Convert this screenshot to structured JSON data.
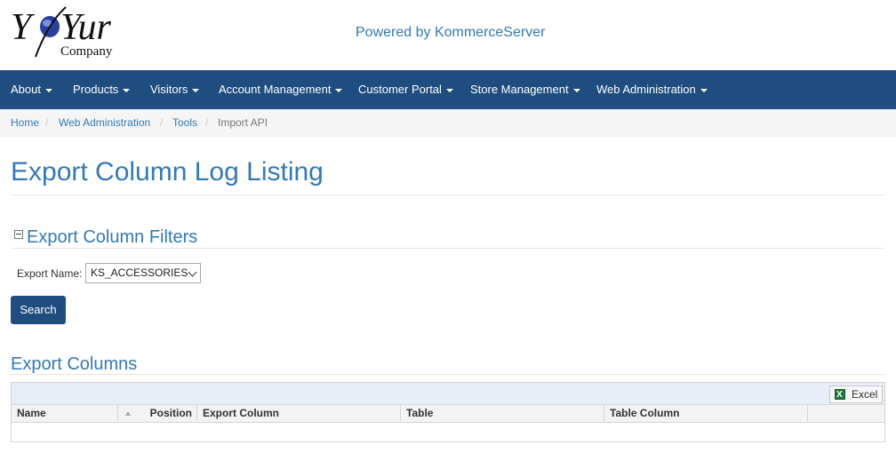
{
  "header": {
    "logo": {
      "main_text": "Yur",
      "sub_text": "Company"
    },
    "powered_by": "Powered by KommerceServer"
  },
  "nav": {
    "items": [
      {
        "label": "About"
      },
      {
        "label": "Products"
      },
      {
        "label": "Visitors"
      },
      {
        "label": "Account Management"
      },
      {
        "label": "Customer Portal"
      },
      {
        "label": "Store Management"
      },
      {
        "label": "Web Administration"
      }
    ]
  },
  "breadcrumb": {
    "items": [
      "Home",
      "Web Administration",
      "Tools",
      "Import API"
    ],
    "separator": "/"
  },
  "page": {
    "title": "Export Column Log Listing"
  },
  "filters": {
    "title": "Export Column Filters",
    "export_name_label": "Export Name:",
    "export_name_value": "KS_ACCESSORIES",
    "search_label": "Search"
  },
  "columns_section": {
    "title": "Export Columns",
    "excel_label": "Excel",
    "headers": [
      "Name",
      "Position",
      "Export Column",
      "Table",
      "Table Column"
    ]
  },
  "colors": {
    "navbar": "#1f4d80",
    "link": "#337ab7",
    "breadcrumb_bg": "#f5f5f5",
    "grid_toolbar_bg": "#e8eef7"
  },
  "icons": {
    "logo": "globe-logo-icon",
    "toggle": "collapse-minus-icon",
    "excel": "excel-icon",
    "sort": "sort-ascending-icon",
    "dropdown": "chevron-down-icon"
  }
}
